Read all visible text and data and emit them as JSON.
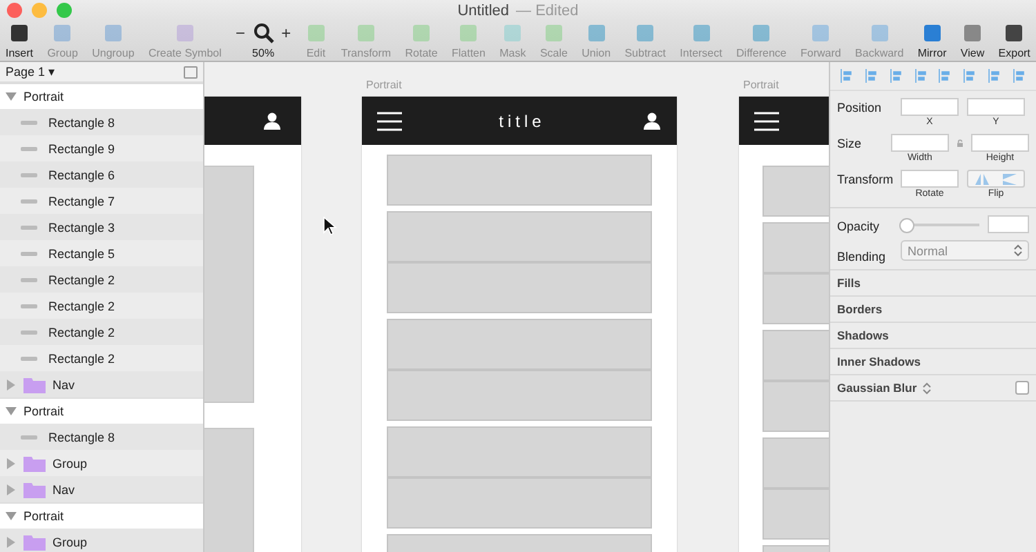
{
  "window": {
    "title": "Untitled",
    "status": "— Edited"
  },
  "toolbar": [
    {
      "label": "Insert",
      "disabled": false
    },
    {
      "label": "Group",
      "disabled": true
    },
    {
      "label": "Ungroup",
      "disabled": true
    },
    {
      "label": "Create Symbol",
      "disabled": true
    },
    {
      "label": "50%",
      "disabled": false,
      "kind": "zoom",
      "minus": "−",
      "plus": "+"
    },
    {
      "label": "Edit",
      "disabled": true
    },
    {
      "label": "Transform",
      "disabled": true
    },
    {
      "label": "Rotate",
      "disabled": true
    },
    {
      "label": "Flatten",
      "disabled": true
    },
    {
      "label": "Mask",
      "disabled": true
    },
    {
      "label": "Scale",
      "disabled": true
    },
    {
      "label": "Union",
      "disabled": true
    },
    {
      "label": "Subtract",
      "disabled": true
    },
    {
      "label": "Intersect",
      "disabled": true
    },
    {
      "label": "Difference",
      "disabled": true
    },
    {
      "label": "Forward",
      "disabled": true
    },
    {
      "label": "Backward",
      "disabled": true
    },
    {
      "label": "Mirror",
      "disabled": false
    },
    {
      "label": "View",
      "disabled": false
    },
    {
      "label": "Export",
      "disabled": false
    }
  ],
  "page": {
    "label": "Page 1",
    "caret": "▾"
  },
  "layers": [
    {
      "name": "Portrait",
      "kind": "artboard",
      "expanded": true,
      "children": [
        {
          "name": "Rectangle 8",
          "kind": "shape"
        },
        {
          "name": "Rectangle 9",
          "kind": "shape"
        },
        {
          "name": "Rectangle 6",
          "kind": "shape"
        },
        {
          "name": "Rectangle 7",
          "kind": "shape"
        },
        {
          "name": "Rectangle 3",
          "kind": "shape"
        },
        {
          "name": "Rectangle 5",
          "kind": "shape"
        },
        {
          "name": "Rectangle 2",
          "kind": "shape"
        },
        {
          "name": "Rectangle 2",
          "kind": "shape"
        },
        {
          "name": "Rectangle 2",
          "kind": "shape"
        },
        {
          "name": "Rectangle 2",
          "kind": "shape"
        },
        {
          "name": "Nav",
          "kind": "group",
          "expanded": false
        }
      ]
    },
    {
      "name": "Portrait",
      "kind": "artboard",
      "expanded": true,
      "children": [
        {
          "name": "Rectangle 8",
          "kind": "shape"
        },
        {
          "name": "Group",
          "kind": "group",
          "expanded": false
        },
        {
          "name": "Nav",
          "kind": "group",
          "expanded": false
        }
      ]
    },
    {
      "name": "Portrait",
      "kind": "artboard",
      "expanded": true,
      "children": [
        {
          "name": "Group",
          "kind": "group",
          "expanded": false
        }
      ]
    }
  ],
  "artboards": [
    {
      "label": "Portrait",
      "title": "title"
    },
    {
      "label": "Portrait"
    }
  ],
  "inspector": {
    "position": {
      "label": "Position",
      "x": "X",
      "y": "Y"
    },
    "size": {
      "label": "Size",
      "width": "Width",
      "height": "Height"
    },
    "transform": {
      "label": "Transform",
      "rotate": "Rotate",
      "flip": "Flip"
    },
    "opacity": {
      "label": "Opacity",
      "level": 0
    },
    "blending": {
      "label": "Blending",
      "value": "Normal"
    },
    "sections": [
      "Fills",
      "Borders",
      "Shadows",
      "Inner Shadows"
    ],
    "blur": {
      "label": "Gaussian Blur",
      "checked": false
    }
  }
}
